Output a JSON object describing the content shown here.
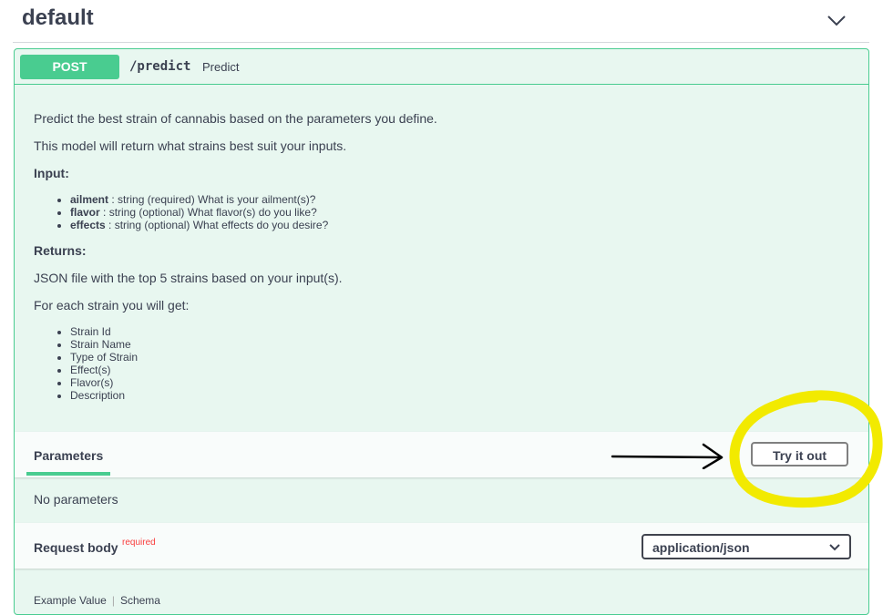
{
  "section": {
    "title": "default"
  },
  "operation": {
    "method": "POST",
    "path": "/predict",
    "summary": "Predict",
    "description": {
      "line1": "Predict the best strain of cannabis based on the parameters you define.",
      "line2": "This model will return what strains best suit your inputs.",
      "input_heading": "Input:",
      "inputs": [
        {
          "name": "ailment",
          "desc": " : string (required) What is your ailment(s)?"
        },
        {
          "name": "flavor",
          "desc": " : string (optional) What flavor(s) do you like?"
        },
        {
          "name": "effects",
          "desc": " : string (optional) What effects do you desire?"
        }
      ],
      "returns_heading": "Returns:",
      "returns_text": "JSON file with the top 5 strains based on your input(s).",
      "each_text": "For each strain you will get:",
      "fields": [
        "Strain Id",
        "Strain Name",
        "Type of Strain",
        "Effect(s)",
        "Flavor(s)",
        "Description"
      ]
    },
    "parameters": {
      "title": "Parameters",
      "try_button": "Try it out",
      "empty_text": "No parameters"
    },
    "request_body": {
      "title": "Request body",
      "required_label": "required",
      "content_type": "application/json",
      "tabs": [
        "Example Value",
        "Schema"
      ]
    }
  },
  "colors": {
    "post_green": "#49cc90",
    "opblock_bg": "#e8f7f0",
    "text": "#3b4151",
    "required_red": "#f93e3e",
    "highlight_yellow": "#f2ea00"
  },
  "icons": {
    "section_toggle": "chevron-down-icon",
    "select_arrow": "chevron-down-icon",
    "annotation": "right-arrow-icon"
  }
}
